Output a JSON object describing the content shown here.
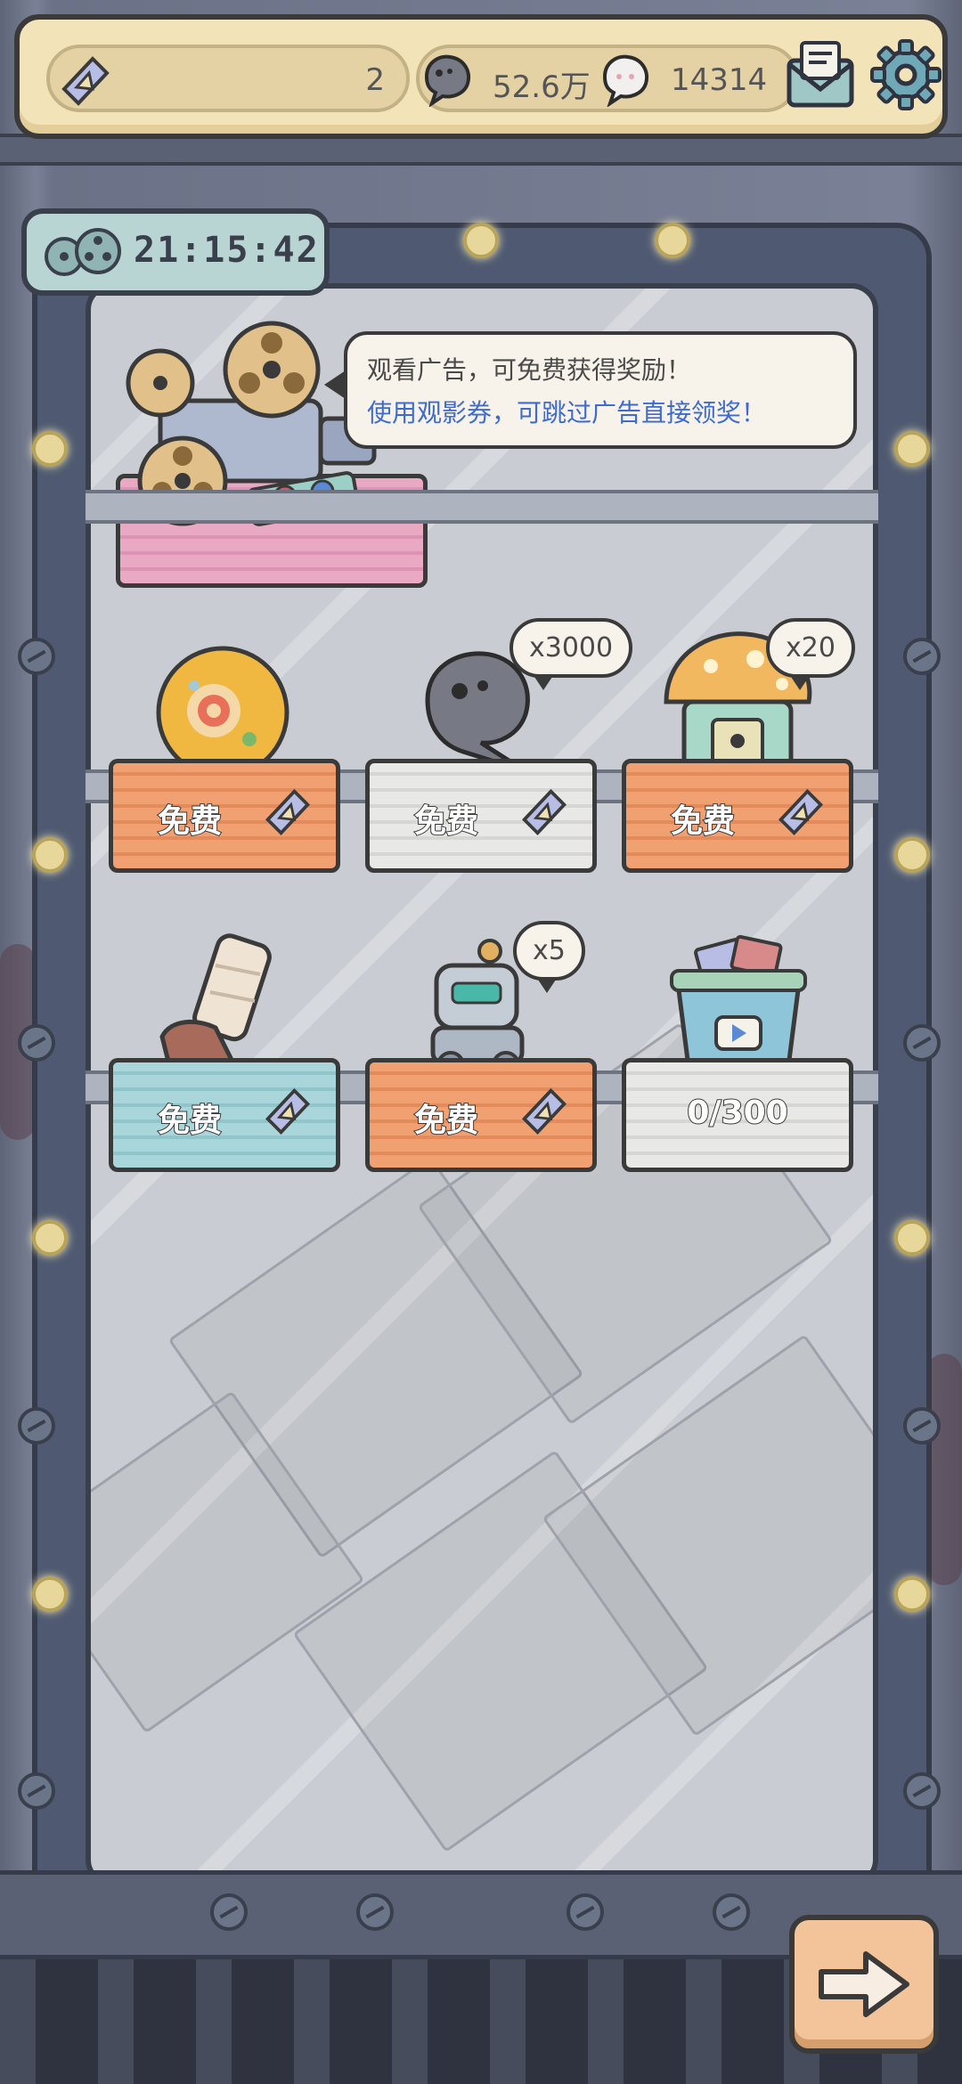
{
  "header": {
    "ticket_count": "2",
    "coins": "52.6万",
    "gems": "14314",
    "icons": {
      "ticket": "film-ticket-icon",
      "coin": "dark-bubble-coin-icon",
      "gem": "light-bubble-gem-icon",
      "mail": "mail-icon",
      "settings": "gear-icon"
    }
  },
  "timer": {
    "value": "21:15:42",
    "icon": "film-reel-icon"
  },
  "info": {
    "line1": "观看广告，可免费获得奖励！",
    "line2": "使用观影券，可跳过广告直接领奖！"
  },
  "rewards": {
    "row1": [
      {
        "item": "orb",
        "towel": "orange",
        "label": "免费",
        "qty": ""
      },
      {
        "item": "dark-bubble-coin",
        "towel": "grey",
        "label": "免费",
        "qty": "x3000"
      },
      {
        "item": "mushroom-house",
        "towel": "orange",
        "label": "免费",
        "qty": "x20"
      }
    ],
    "row2": [
      {
        "item": "bandaged-boot",
        "towel": "blue",
        "label": "免费",
        "qty": ""
      },
      {
        "item": "robot",
        "towel": "orange",
        "label": "免费",
        "qty": "x5"
      },
      {
        "item": "ticket-bucket",
        "towel": "grey",
        "label": "0/300",
        "qty": ""
      }
    ]
  },
  "colors": {
    "info_link": "#3d6bd0",
    "towel_orange": "#f1a071",
    "towel_grey": "#e8e8e6",
    "towel_blue": "#a9d6db",
    "towel_pink": "#e9a9c3"
  },
  "next_button_icon": "arrow-right-icon"
}
